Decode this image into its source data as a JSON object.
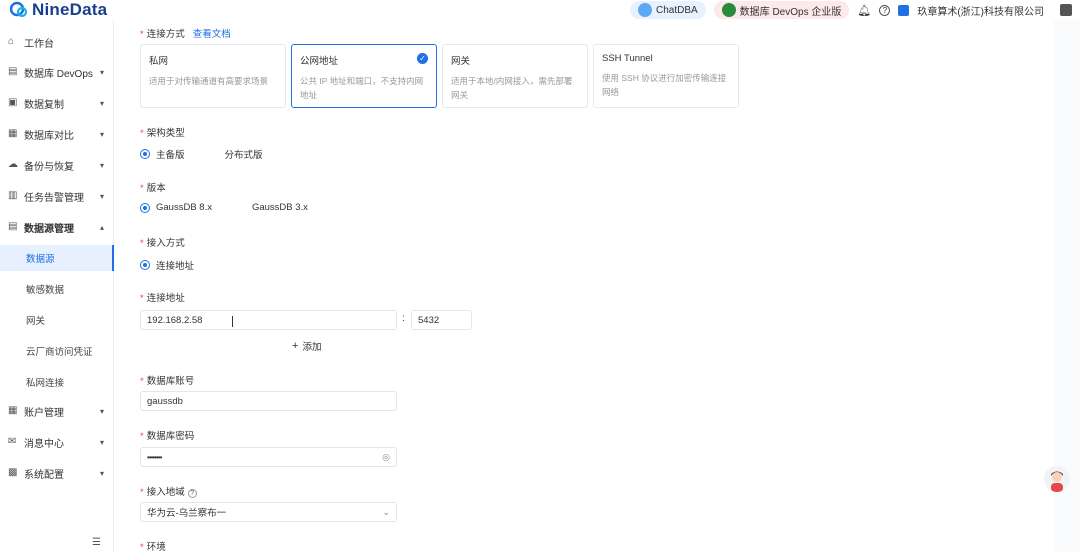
{
  "app": {
    "logo_text": "NineData"
  },
  "topbar": {
    "chatdba": "ChatDBA",
    "devops_edition": "数据库 DevOps 企业版",
    "company": "玖章算术(浙江)科技有限公司"
  },
  "sidebar": {
    "items": [
      {
        "label": "工作台",
        "icon": "home-icon",
        "chevron": false
      },
      {
        "label": "数据库 DevOps",
        "icon": "devops-icon",
        "chevron": true
      },
      {
        "label": "数据复制",
        "icon": "replication-icon",
        "chevron": true
      },
      {
        "label": "数据库对比",
        "icon": "compare-icon",
        "chevron": true
      },
      {
        "label": "备份与恢复",
        "icon": "backup-icon",
        "chevron": true
      },
      {
        "label": "任务告警管理",
        "icon": "alarm-icon",
        "chevron": true
      },
      {
        "label": "数据源管理",
        "icon": "datasource-icon",
        "chevron": true
      }
    ],
    "sub_items": [
      {
        "label": "数据源",
        "active": true
      },
      {
        "label": "敏感数据",
        "active": false
      },
      {
        "label": "网关",
        "active": false
      },
      {
        "label": "云厂商访问凭证",
        "active": false
      },
      {
        "label": "私网连接",
        "active": false
      }
    ],
    "bottom_items": [
      {
        "label": "账户管理",
        "icon": "account-icon"
      },
      {
        "label": "消息中心",
        "icon": "message-icon"
      },
      {
        "label": "系统配置",
        "icon": "settings-icon"
      }
    ]
  },
  "form": {
    "connection_label": "连接方式",
    "doc_link": "查看文档",
    "connection_cards": [
      {
        "title": "私网",
        "desc": "适用于对传输通道有高要求场景",
        "selected": false
      },
      {
        "title": "公网地址",
        "desc": "公共 IP 地址和端口，不支持内网地址",
        "selected": true
      },
      {
        "title": "网关",
        "desc": "适用于本地/内网接入，需先部署网关",
        "selected": false
      },
      {
        "title": "SSH Tunnel",
        "desc": "使用 SSH 协议进行加密传输连接网络",
        "selected": false
      }
    ],
    "arch_label": "架构类型",
    "arch_options": [
      {
        "label": "主备版",
        "selected": true
      },
      {
        "label": "分布式版",
        "selected": false
      }
    ],
    "version_label": "版本",
    "version_options": [
      {
        "label": "GaussDB 8.x",
        "selected": true
      },
      {
        "label": "GaussDB 3.x",
        "selected": false
      }
    ],
    "access_label": "接入方式",
    "access_options": [
      {
        "label": "连接地址",
        "selected": true
      }
    ],
    "address_label": "连接地址",
    "host_value": "192.168.2.58",
    "port_value": "5432",
    "add_label": "添加",
    "account_label": "数据库账号",
    "account_value": "gaussdb",
    "password_label": "数据库密码",
    "password_value": "••••••••",
    "region_label": "接入地域",
    "region_value": "华为云-乌兰察布一",
    "env_label": "环境"
  }
}
